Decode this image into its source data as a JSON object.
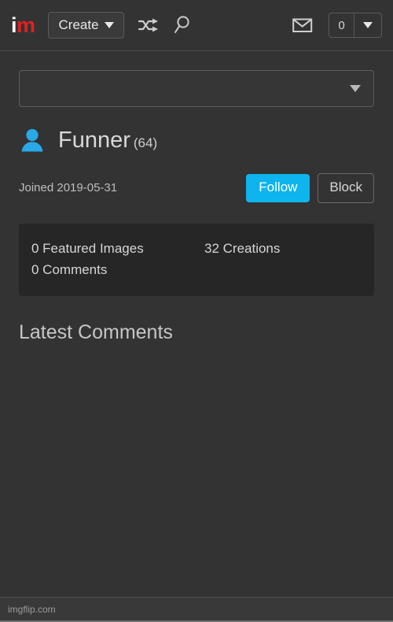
{
  "site": {
    "logo_i": "i",
    "logo_m": "m",
    "footer_watermark": "imgflip.com"
  },
  "header": {
    "create_label": "Create",
    "shuffle_icon": "shuffle-icon",
    "search_icon": "search-icon",
    "mail_icon": "mail-icon",
    "notification_count": "0",
    "notification_caret_icon": "chevron-down-icon",
    "create_caret_icon": "chevron-down-icon"
  },
  "filter_select": {
    "value": "",
    "caret_icon": "chevron-down-icon"
  },
  "profile": {
    "avatar_icon": "user-avatar-icon",
    "username": "Funner",
    "user_points": "(64)",
    "joined": "Joined 2019-05-31",
    "follow_label": "Follow",
    "block_label": "Block",
    "accent_color": "#0db4ee",
    "avatar_color": "#29a9e8",
    "logo_red": "#e02121"
  },
  "stats": {
    "featured_images": "0 Featured Images",
    "creations": "32 Creations",
    "comments": "0 Comments"
  },
  "sections": {
    "latest_comments_title": "Latest Comments"
  }
}
